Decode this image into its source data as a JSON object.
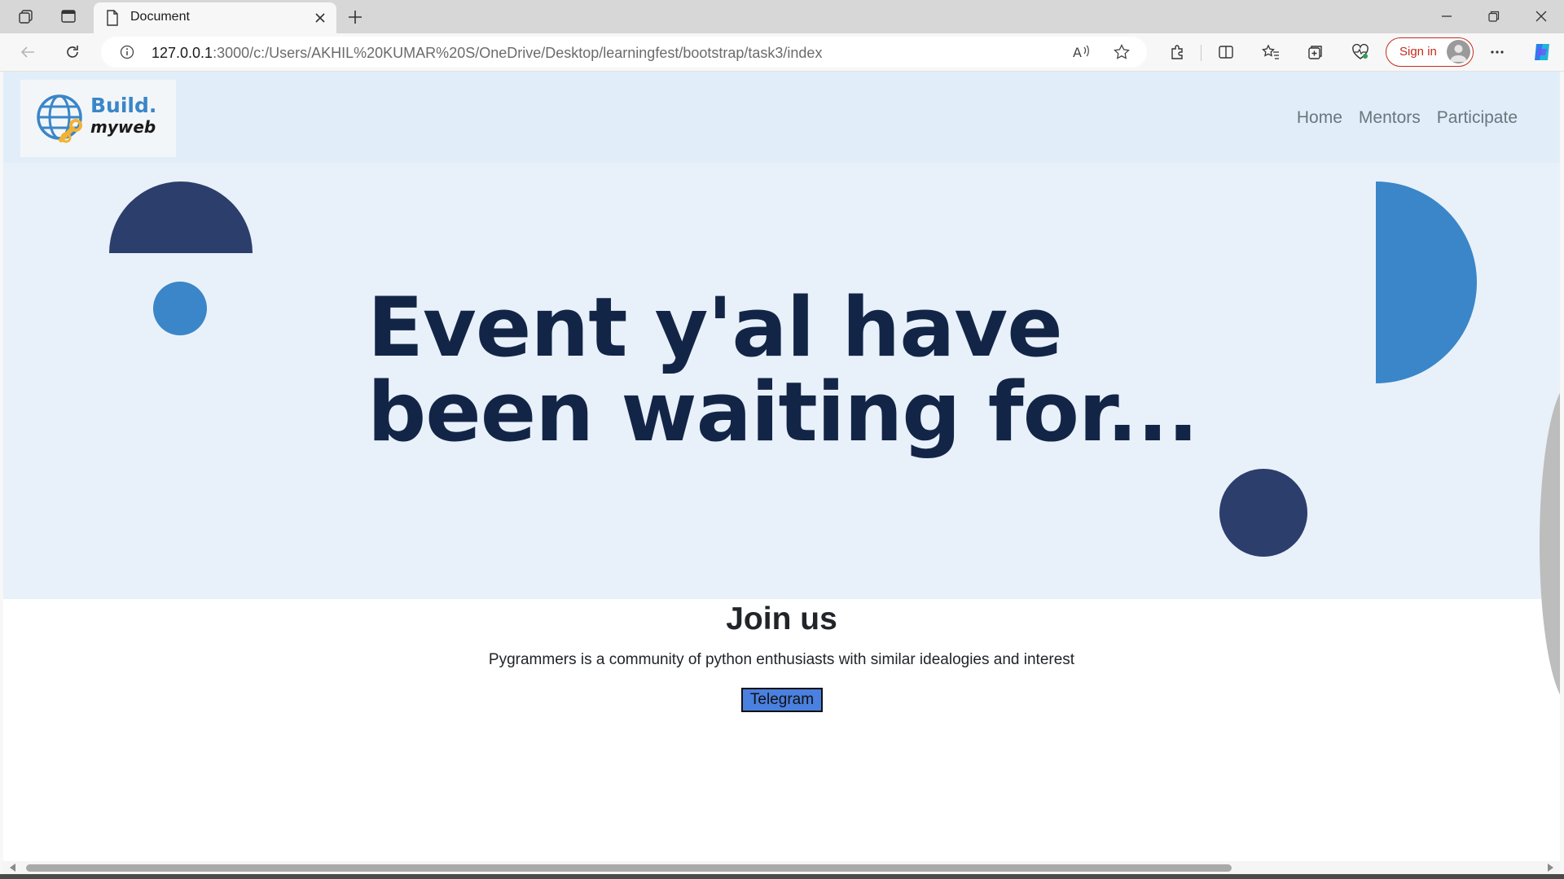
{
  "browser": {
    "tab_title": "Document",
    "url_host": "127.0.0.1",
    "url_rest": ":3000/c:/Users/AKHIL%20KUMAR%20S/OneDrive/Desktop/learningfest/bootstrap/task3/index",
    "signin_label": "Sign in"
  },
  "logo": {
    "line1": "Build.",
    "line2": "myweb"
  },
  "nav": {
    "home": "Home",
    "mentors": "Mentors",
    "participate": "Participate"
  },
  "hero": {
    "line1": "Event y'al have",
    "line2": "been waiting for..."
  },
  "join": {
    "title": "Join us",
    "description": "Pygrammers is a community of python enthusiasts with similar idealogies and interest",
    "button": "Telegram"
  },
  "colors": {
    "navy": "#2c3e6b",
    "blue": "#3a86c8",
    "headline": "#132547",
    "hero_bg": "#e8f1fa"
  }
}
